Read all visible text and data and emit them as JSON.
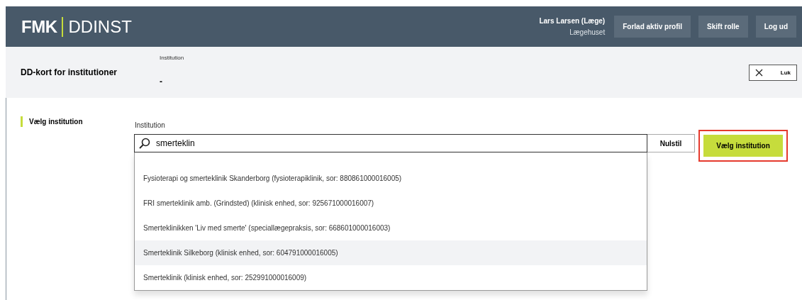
{
  "header": {
    "logo_primary": "FMK",
    "logo_secondary": "DDINST",
    "user_name": "Lars Larsen (Læge)",
    "user_org": "Lægehuset",
    "buttons": [
      "Forlad aktiv profil",
      "Skift rolle",
      "Log ud"
    ]
  },
  "subheader": {
    "title": "DD-kort for institutioner",
    "field_label": "Institution",
    "field_value": "-",
    "close_label": "Luk"
  },
  "sidebar": {
    "items": [
      {
        "label": "Vælg institution",
        "selected": true
      }
    ]
  },
  "form": {
    "label": "Institution",
    "search_value": "smerteklin",
    "reset_label": "Nulstil",
    "submit_label": "Vælg institution",
    "submit_highlighted": true,
    "options": [
      {
        "label": "Fysioterapi og smerteklinik Skanderborg (fysioterapiklinik, sor: 880861000016005)",
        "selected": false
      },
      {
        "label": "FRI smerteklinik amb. (Grindsted) (klinisk enhed, sor: 925671000016007)",
        "selected": false
      },
      {
        "label": "Smerteklinikken 'Liv med smerte' (speciallægepraksis, sor: 668601000016003)",
        "selected": false
      },
      {
        "label": "Smerteklinik Silkeborg (klinisk enhed, sor: 604791000016005)",
        "selected": true
      },
      {
        "label": "Smerteklinik (klinisk enhed, sor: 252991000016009)",
        "selected": false
      }
    ]
  }
}
